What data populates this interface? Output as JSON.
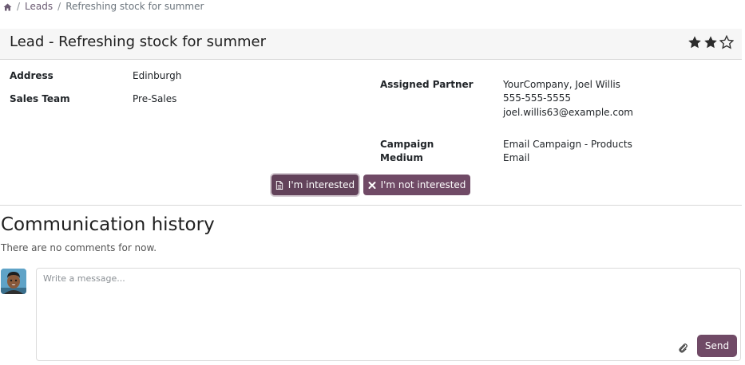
{
  "breadcrumb": {
    "home_icon": "home-icon",
    "items": [
      "Leads",
      "Refreshing stock for summer"
    ],
    "separator": "/"
  },
  "header": {
    "title": "Lead - Refreshing stock for summer",
    "rating": {
      "filled": 2,
      "total": 3
    }
  },
  "fields": {
    "address_label": "Address",
    "address_value": "Edinburgh",
    "sales_team_label": "Sales Team",
    "sales_team_value": "Pre-Sales",
    "assigned_partner_label": "Assigned Partner",
    "assigned_partner_name": "YourCompany, Joel Willis",
    "assigned_partner_phone": "555-555-5555",
    "assigned_partner_email": "joel.willis63@example.com",
    "campaign_label": "Campaign",
    "campaign_value": "Email Campaign - Products",
    "medium_label": "Medium",
    "medium_value": "Email"
  },
  "actions": {
    "interested_label": "I'm interested",
    "interested_icon": "document-icon",
    "not_interested_label": "I'm not interested",
    "not_interested_icon": "close-icon"
  },
  "communication": {
    "title": "Communication history",
    "empty_text": "There are no comments for now.",
    "composer_placeholder": "Write a message...",
    "composer_value": "",
    "send_label": "Send",
    "attach_icon": "paperclip-icon"
  },
  "colors": {
    "primary": "#704a66",
    "header_bg": "#f6f6f6",
    "star": "#2b2b2b"
  }
}
